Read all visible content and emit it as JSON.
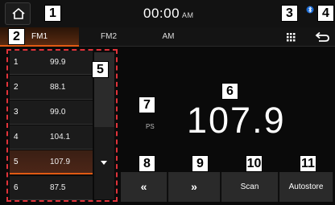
{
  "status_bar": {
    "time": "00:00",
    "ampm": "AM"
  },
  "bands": [
    {
      "label": "FM1",
      "active": true
    },
    {
      "label": "FM2",
      "active": false
    },
    {
      "label": "AM",
      "active": false
    }
  ],
  "presets": [
    {
      "num": "1",
      "freq": "99.9",
      "active": false
    },
    {
      "num": "2",
      "freq": "88.1",
      "active": false
    },
    {
      "num": "3",
      "freq": "99.0",
      "active": false
    },
    {
      "num": "4",
      "freq": "104.1",
      "active": false
    },
    {
      "num": "5",
      "freq": "107.9",
      "active": true
    },
    {
      "num": "6",
      "freq": "87.5",
      "active": false
    }
  ],
  "station": {
    "ps_label": "PS",
    "frequency": "107.9"
  },
  "controls": {
    "seek_back": "«",
    "seek_forward": "»",
    "scan": "Scan",
    "autostore": "Autostore"
  },
  "callouts": [
    "1",
    "2",
    "3",
    "4",
    "5",
    "6",
    "7",
    "8",
    "9",
    "10",
    "11"
  ],
  "colors": {
    "accent": "#e05a14",
    "callout_border": "#e0333a"
  }
}
